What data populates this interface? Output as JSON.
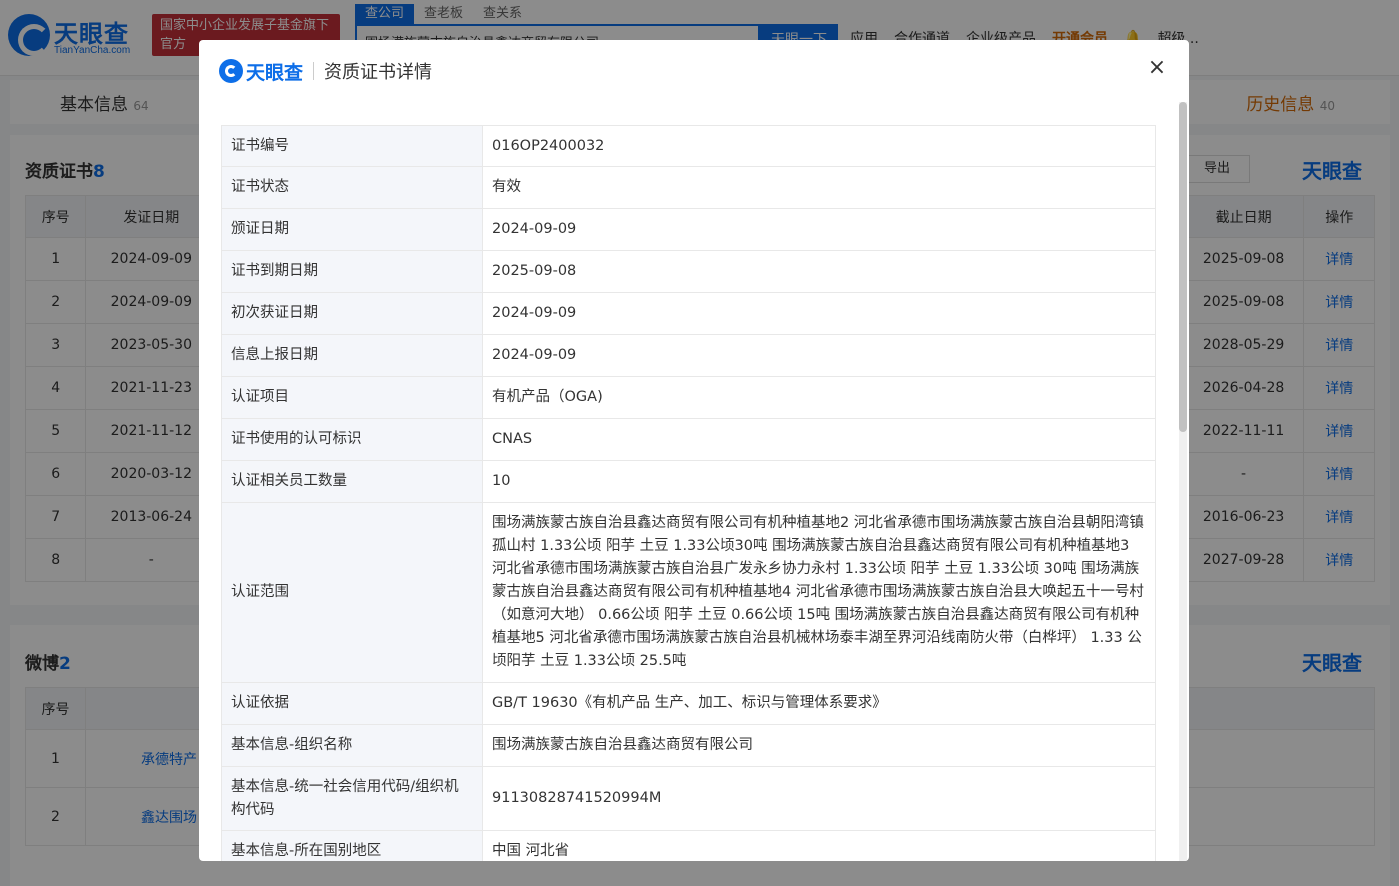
{
  "header": {
    "logo_text": "天眼查",
    "logo_sub": "TianYanCha.com",
    "fund_badge_line1": "国家中小企业发展子基金旗下",
    "fund_badge_line2": "官方",
    "search_tabs": [
      "查公司",
      "查老板",
      "查关系"
    ],
    "search_value": "围场满族蒙古族自治县鑫达商贸有限公司",
    "search_button": "天眼一下",
    "nav": [
      "应用",
      "合作通道",
      "企业级产品"
    ],
    "vip_label": "开通会员",
    "user": "超级..."
  },
  "sub_tabs": {
    "basic": "基本信息",
    "basic_count": "64",
    "history": "历史信息",
    "history_count": "40"
  },
  "cert_panel": {
    "title": "资质证书",
    "count": "8",
    "export": "导出",
    "watermark": "天眼查",
    "columns": [
      "序号",
      "发证日期",
      "截止日期",
      "操作"
    ],
    "rows": [
      {
        "no": "1",
        "issue": "2024-09-09",
        "end": "2025-09-08",
        "action": "详情"
      },
      {
        "no": "2",
        "issue": "2024-09-09",
        "end": "2025-09-08",
        "action": "详情"
      },
      {
        "no": "3",
        "issue": "2023-05-30",
        "end": "2028-05-29",
        "action": "详情"
      },
      {
        "no": "4",
        "issue": "2021-11-23",
        "end": "2026-04-28",
        "action": "详情"
      },
      {
        "no": "5",
        "issue": "2021-11-12",
        "end": "2022-11-11",
        "action": "详情"
      },
      {
        "no": "6",
        "issue": "2020-03-12",
        "end": "-",
        "action": "详情"
      },
      {
        "no": "7",
        "issue": "2013-06-24",
        "end": "2016-06-23",
        "action": "详情"
      },
      {
        "no": "8",
        "issue": "-",
        "end": "2027-09-28",
        "action": "详情"
      }
    ]
  },
  "weibo_panel": {
    "title": "微博",
    "count": "2",
    "watermark": "天眼查",
    "column": "序号",
    "rows": [
      {
        "no": "1",
        "name": "承德特产"
      },
      {
        "no": "2",
        "name": "鑫达围场"
      }
    ]
  },
  "modal": {
    "logo_text": "天眼查",
    "title": "资质证书详情",
    "close": "×",
    "fields": [
      {
        "key": "证书编号",
        "value": "016OP2400032"
      },
      {
        "key": "证书状态",
        "value": "有效"
      },
      {
        "key": "颁证日期",
        "value": "2024-09-09"
      },
      {
        "key": "证书到期日期",
        "value": "2025-09-08"
      },
      {
        "key": "初次获证日期",
        "value": "2024-09-09"
      },
      {
        "key": "信息上报日期",
        "value": "2024-09-09"
      },
      {
        "key": "认证项目",
        "value": "有机产品（OGA)"
      },
      {
        "key": "证书使用的认可标识",
        "value": "CNAS"
      },
      {
        "key": "认证相关员工数量",
        "value": "10"
      },
      {
        "key": "认证范围",
        "value": "围场满族蒙古族自治县鑫达商贸有限公司有机种植基地2 河北省承德市围场满族蒙古族自治县朝阳湾镇孤山村 1.33公顷 阳芋 土豆 1.33公顷30吨 围场满族蒙古族自治县鑫达商贸有限公司有机种植基地3 河北省承德市围场满族蒙古族自治县广发永乡协力永村 1.33公顷 阳芋 土豆 1.33公顷 30吨 围场满族蒙古族自治县鑫达商贸有限公司有机种植基地4 河北省承德市围场满族蒙古族自治县大唤起五十一号村（如意河大地） 0.66公顷 阳芋 土豆 0.66公顷 15吨 围场满族蒙古族自治县鑫达商贸有限公司有机种植基地5 河北省承德市围场满族蒙古族自治县机械林场泰丰湖至界河沿线南防火带（白桦坪） 1.33 公顷阳芋 土豆 1.33公顷 25.5吨"
      },
      {
        "key": "认证依据",
        "value": "GB/T 19630《有机产品 生产、加工、标识与管理体系要求》"
      },
      {
        "key": "基本信息-组织名称",
        "value": "围场满族蒙古族自治县鑫达商贸有限公司"
      },
      {
        "key": "基本信息-统一社会信用代码/组织机构代码",
        "value": "91130828741520994M"
      },
      {
        "key": "基本信息-所在国别地区",
        "value": "中国 河北省"
      }
    ]
  }
}
